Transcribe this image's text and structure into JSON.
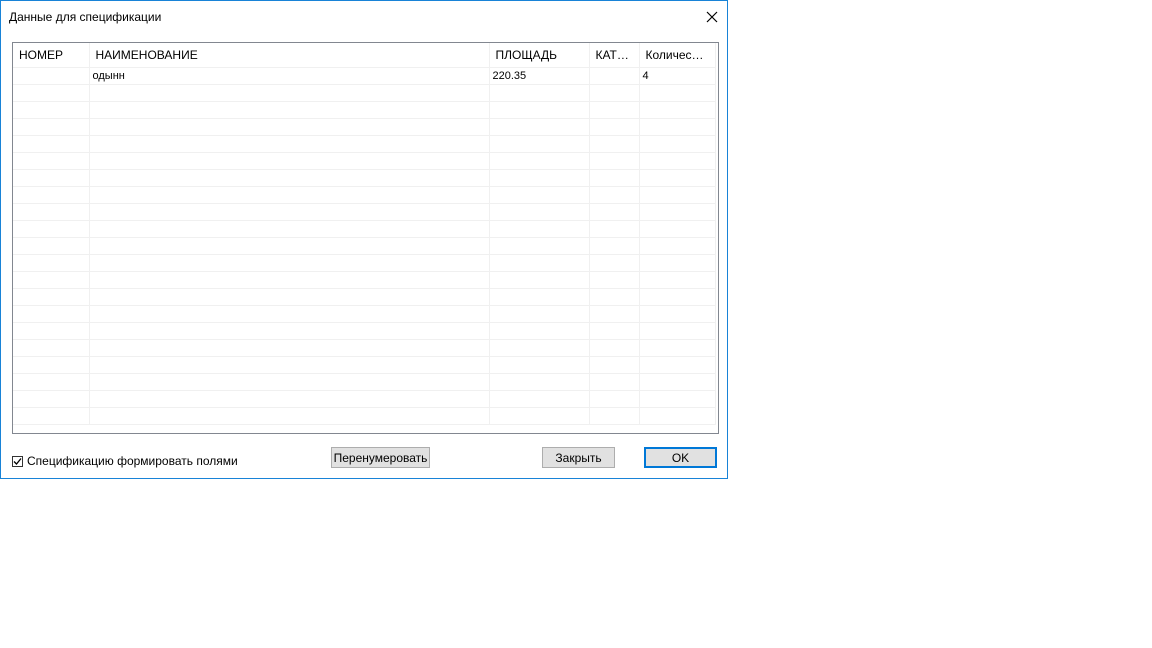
{
  "window": {
    "title": "Данные для спецификации"
  },
  "table": {
    "columns": [
      "НОМЕР",
      "НАИМЕНОВАНИЕ",
      "ПЛОЩАДЬ",
      "КАТЕ...",
      "Количество"
    ],
    "rows": [
      [
        "",
        "одынн",
        "220.35",
        "",
        "4"
      ]
    ]
  },
  "footer": {
    "checkbox_label": "Спецификацию формировать полями",
    "checkbox_checked": true,
    "renumber_label": "Перенумеровать",
    "close_label": "Закрыть",
    "ok_label": "OK"
  }
}
